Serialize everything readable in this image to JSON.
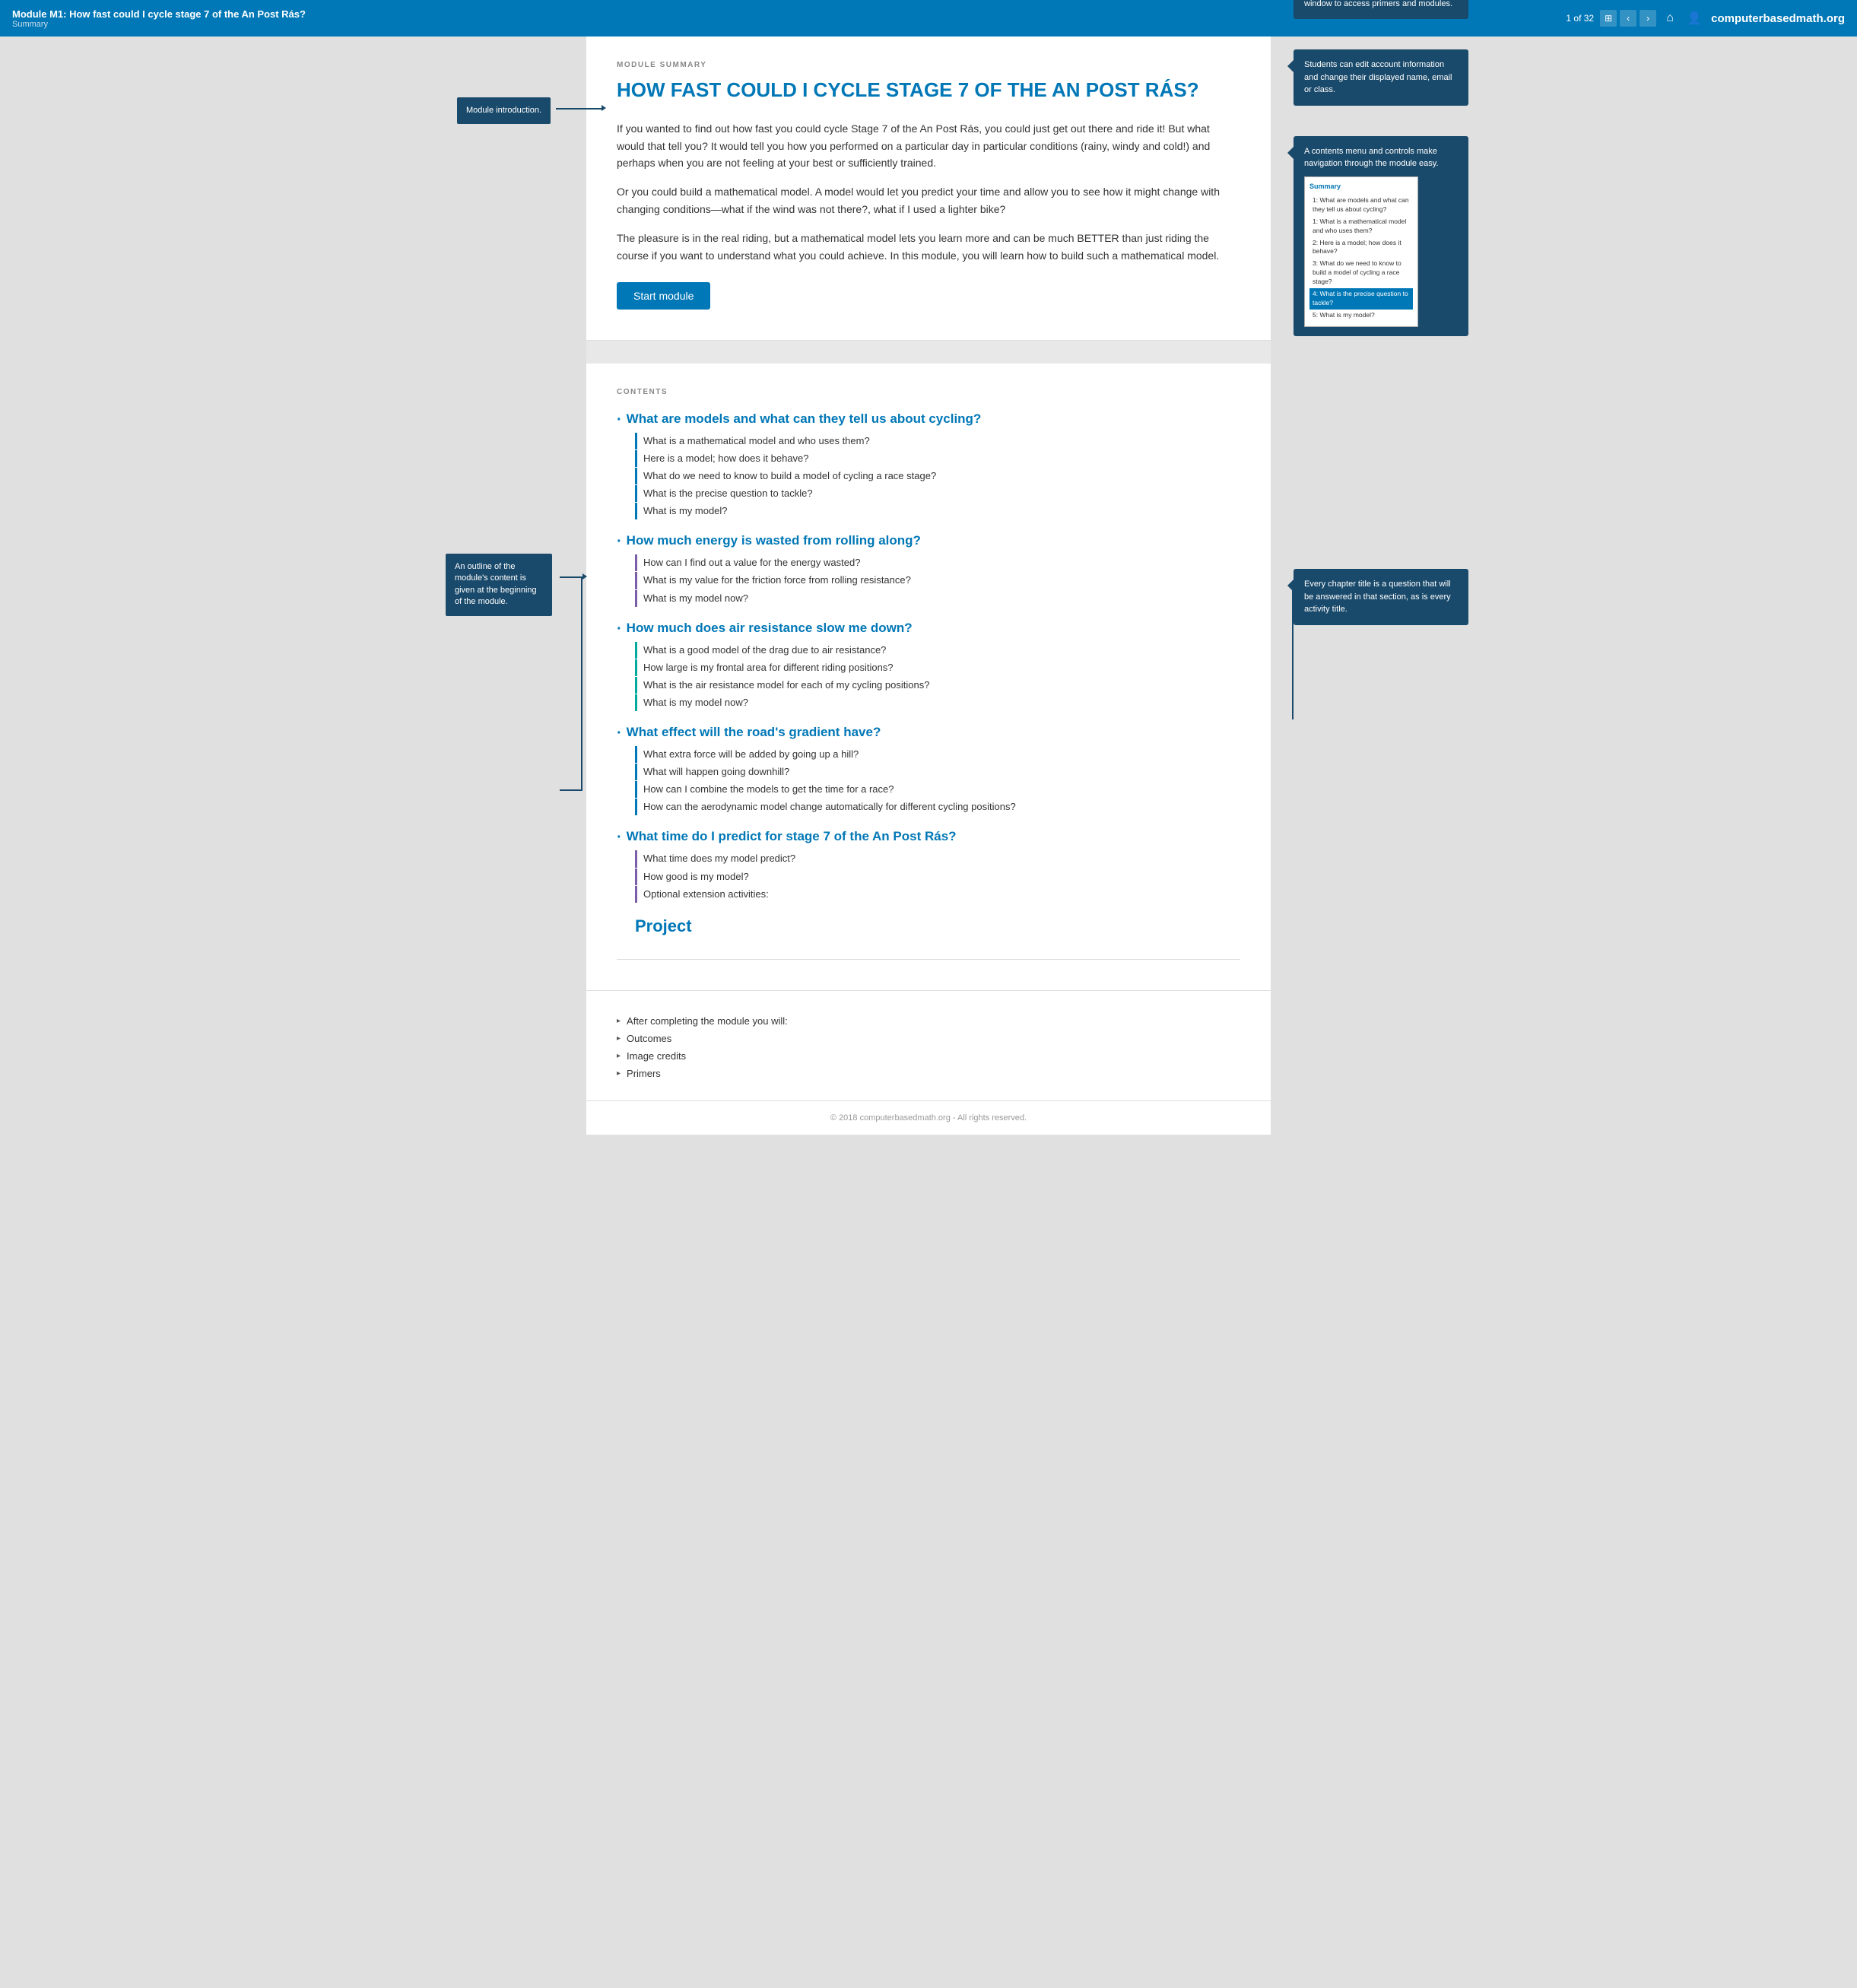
{
  "topnav": {
    "title": "Module M1: How fast could I cycle stage 7 of the An Post Rás?",
    "subtitle": "Summary",
    "brand": "computerbasedmath",
    "brand_suffix": ".org",
    "page_current": "1",
    "page_total": "32",
    "page_display": "1 of 32"
  },
  "module": {
    "label": "MODULE SUMMARY",
    "title": "HOW FAST COULD I CYCLE STAGE 7 OF THE AN POST RÁS?",
    "paragraphs": [
      "If you wanted to find out how fast you could cycle Stage 7 of the An Post Rás, you could just get out there and ride it! But what would that tell you? It would tell you how you performed on a particular day in particular conditions (rainy, windy and cold!) and perhaps when you are not feeling at your best or sufficiently trained.",
      "Or you could build a mathematical model. A model would let you predict your time and allow you to see how it might change with changing conditions—what if the wind was not there?, what if I used a lighter bike?",
      "The pleasure is in the real riding, but a mathematical model lets you learn more and can be much BETTER than just riding the course if you want to understand what you could achieve. In this module, you will learn how to build such a mathematical model."
    ],
    "start_button": "Start module"
  },
  "contents": {
    "label": "CONTENTS",
    "chapters": [
      {
        "title": "What are models and what can they tell us about cycling?",
        "items": [
          "What is a mathematical model and who uses them?",
          "Here is a model; how does it behave?",
          "What do we need to know to build a model of cycling a race stage?",
          "What is the precise question to tackle?",
          "What is my model?"
        ],
        "item_color": "blue"
      },
      {
        "title": "How much energy is wasted from rolling along?",
        "items": [
          "How can I find out a value for the energy wasted?",
          "What is my value for the friction force from rolling resistance?",
          "What is my model now?"
        ],
        "item_color": "purple"
      },
      {
        "title": "How much does air resistance slow me down?",
        "items": [
          "What is a good model of the drag due to air resistance?",
          "How large is my frontal area for different riding positions?",
          "What is the air resistance model for each of my cycling positions?",
          "What is my model now?"
        ],
        "item_color": "teal"
      },
      {
        "title": "What effect will the road's gradient have?",
        "items": [
          "What extra force will be added by going up a hill?",
          "What will happen going downhill?",
          "How can I combine the models to get the time for a race?",
          "How can the aerodynamic model change automatically for different cycling positions?"
        ],
        "item_color": "blue"
      },
      {
        "title": "What time do I predict for stage 7 of the An Post Rás?",
        "items": [
          "What time does my model predict?",
          "How good is my model?",
          "Optional extension activities:"
        ],
        "item_color": "purple"
      }
    ],
    "project_label": "Project"
  },
  "footer_links": [
    "After completing the module you will:",
    "Outcomes",
    "Image credits",
    "Primers"
  ],
  "copyright": "© 2018 computerbasedmath.org - All rights reserved.",
  "annotations": {
    "module_intro": "Module introduction.",
    "outline": "An outline of the module's content is given at the beginning of the module.",
    "chapter_questions": "Every chapter title is a question that will be answered in that section, as is every activity title."
  },
  "callouts": {
    "welcome": "Open the welcome screen in another window to access primers and modules.",
    "account": "Students can edit account information and change their displayed name, email or class.",
    "contents_nav": "A contents menu and controls make navigation through the module easy."
  },
  "mini_nav": {
    "summary_label": "Summary",
    "items": [
      "1: What are models and what can they tell us about cycling?",
      "1: What is a mathematical model and who uses them?",
      "2: Here is a model; how does it behave?",
      "3: What do we need to know to build a model of cycling a race stage?",
      "4: What is the precise question to tackle?",
      "5: What is my model?"
    ],
    "active_index": 3
  }
}
